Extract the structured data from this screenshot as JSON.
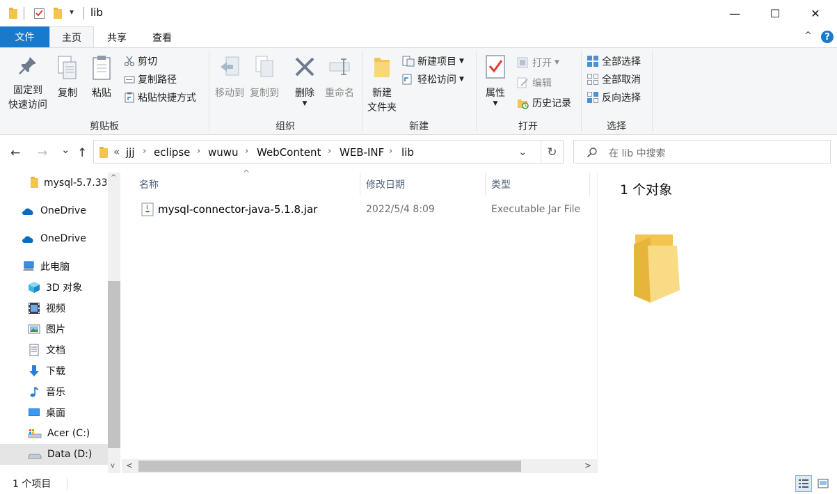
{
  "window": {
    "title": "lib",
    "quick_access_caret": "▾",
    "minimize": "—",
    "maximize": "☐",
    "close": "✕"
  },
  "ribbon_tabs": {
    "file": "文件",
    "home": "主页",
    "share": "共享",
    "view": "查看",
    "collapse": "^",
    "help": "?"
  },
  "ribbon": {
    "clipboard": {
      "group_label": "剪贴板",
      "pin_line1": "固定到",
      "pin_line2": "快速访问",
      "copy": "复制",
      "paste": "粘贴",
      "cut": "剪切",
      "copy_path": "复制路径",
      "paste_shortcut": "粘贴快捷方式"
    },
    "organize": {
      "group_label": "组织",
      "move_to": "移动到",
      "copy_to": "复制到",
      "delete": "删除",
      "rename": "重命名"
    },
    "new": {
      "group_label": "新建",
      "new_folder_line1": "新建",
      "new_folder_line2": "文件夹",
      "new_item": "新建项目",
      "easy_access": "轻松访问"
    },
    "open": {
      "group_label": "打开",
      "properties": "属性",
      "open": "打开",
      "edit": "编辑",
      "history": "历史记录"
    },
    "select": {
      "group_label": "选择",
      "select_all": "全部选择",
      "select_none": "全部取消",
      "invert": "反向选择"
    }
  },
  "nav": {
    "back": "←",
    "forward": "→",
    "recent": "⌄",
    "up": "↑",
    "breadcrumb_overflow": "«",
    "breadcrumb": [
      "jjj",
      "eclipse",
      "wuwu",
      "WebContent",
      "WEB-INF",
      "lib"
    ],
    "refresh": "↻",
    "search_placeholder": "在 lib 中搜索"
  },
  "navpane": {
    "items": [
      {
        "label": "mysql-5.7.33",
        "icon": "folder-icon"
      },
      {
        "label": "OneDrive",
        "icon": "cloud-icon"
      },
      {
        "label": "OneDrive",
        "icon": "cloud-icon"
      },
      {
        "label": "此电脑",
        "icon": "computer-icon"
      },
      {
        "label": "3D 对象",
        "icon": "cube-icon"
      },
      {
        "label": "视频",
        "icon": "video-icon"
      },
      {
        "label": "图片",
        "icon": "picture-icon"
      },
      {
        "label": "文档",
        "icon": "document-icon"
      },
      {
        "label": "下载",
        "icon": "download-icon"
      },
      {
        "label": "音乐",
        "icon": "music-icon"
      },
      {
        "label": "桌面",
        "icon": "desktop-icon"
      },
      {
        "label": "Acer (C:)",
        "icon": "drive-icon"
      },
      {
        "label": "Data (D:)",
        "icon": "drive-icon"
      }
    ]
  },
  "filelist": {
    "columns": [
      "名称",
      "修改日期",
      "类型"
    ],
    "rows": [
      {
        "name": "mysql-connector-java-5.1.8.jar",
        "date": "2022/5/4 8:09",
        "type": "Executable Jar File"
      }
    ]
  },
  "preview": {
    "title": "1 个对象"
  },
  "status": {
    "count": "1 个项目"
  },
  "colors": {
    "accent": "#1979ca",
    "folder": "#f3c550",
    "selection": "#e5e5e5"
  }
}
